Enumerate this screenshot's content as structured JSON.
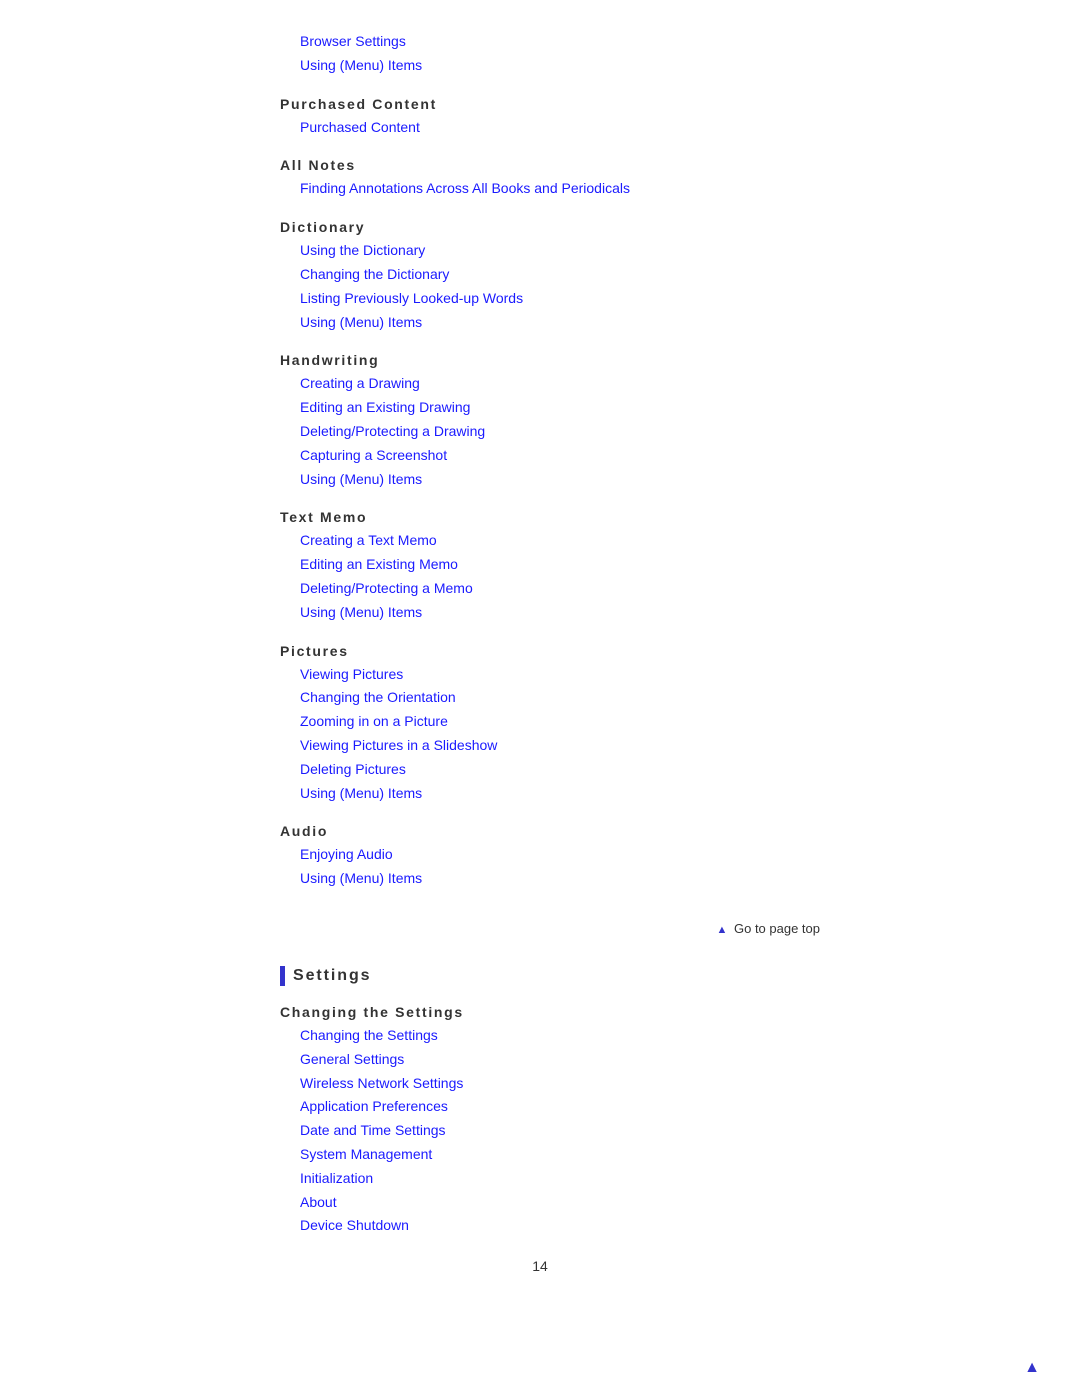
{
  "toc": {
    "sections": [
      {
        "id": "purchased-content-section",
        "header": "Purchased Content",
        "header_style": "spaced",
        "items": [
          {
            "id": "purchased-content-link",
            "label": "Purchased Content"
          }
        ]
      },
      {
        "id": "all-notes-section",
        "header": "All Notes",
        "header_style": "spaced",
        "items": [
          {
            "id": "finding-annotations-link",
            "label": "Finding Annotations Across All Books and Periodicals"
          }
        ]
      },
      {
        "id": "dictionary-section",
        "header": "Dictionary",
        "header_style": "spaced",
        "items": [
          {
            "id": "using-dictionary-link",
            "label": "Using the Dictionary"
          },
          {
            "id": "changing-dictionary-link",
            "label": "Changing the Dictionary"
          },
          {
            "id": "listing-words-link",
            "label": "Listing Previously Looked-up Words"
          },
          {
            "id": "dictionary-menu-link",
            "label": "Using (Menu) Items"
          }
        ]
      },
      {
        "id": "handwriting-section",
        "header": "Handwriting",
        "header_style": "spaced",
        "items": [
          {
            "id": "creating-drawing-link",
            "label": "Creating a Drawing"
          },
          {
            "id": "editing-drawing-link",
            "label": "Editing an Existing Drawing"
          },
          {
            "id": "deleting-drawing-link",
            "label": "Deleting/Protecting a Drawing"
          },
          {
            "id": "capturing-screenshot-link",
            "label": "Capturing a Screenshot"
          },
          {
            "id": "handwriting-menu-link",
            "label": "Using (Menu) Items"
          }
        ]
      },
      {
        "id": "text-memo-section",
        "header": "Text Memo",
        "header_style": "spaced",
        "items": [
          {
            "id": "creating-text-memo-link",
            "label": "Creating a Text Memo"
          },
          {
            "id": "editing-memo-link",
            "label": "Editing an Existing Memo"
          },
          {
            "id": "deleting-memo-link",
            "label": "Deleting/Protecting a Memo"
          },
          {
            "id": "text-memo-menu-link",
            "label": "Using (Menu) Items"
          }
        ]
      },
      {
        "id": "pictures-section",
        "header": "Pictures",
        "header_style": "spaced",
        "items": [
          {
            "id": "viewing-pictures-link",
            "label": "Viewing Pictures"
          },
          {
            "id": "changing-orientation-link",
            "label": "Changing the Orientation"
          },
          {
            "id": "zooming-picture-link",
            "label": "Zooming in on a Picture"
          },
          {
            "id": "viewing-slideshow-link",
            "label": "Viewing Pictures in a Slideshow"
          },
          {
            "id": "deleting-pictures-link",
            "label": "Deleting Pictures"
          },
          {
            "id": "pictures-menu-link",
            "label": "Using (Menu) Items"
          }
        ]
      },
      {
        "id": "audio-section",
        "header": "Audio",
        "header_style": "spaced",
        "items": [
          {
            "id": "enjoying-audio-link",
            "label": "Enjoying Audio"
          },
          {
            "id": "audio-menu-link",
            "label": "Using (Menu) Items"
          }
        ]
      }
    ],
    "settings_section": {
      "id": "settings-section",
      "header": "Settings",
      "subsections": [
        {
          "id": "changing-settings-subsection",
          "header": "Changing the Settings",
          "header_style": "spaced",
          "items": [
            {
              "id": "changing-settings-link",
              "label": "Changing the Settings"
            },
            {
              "id": "general-settings-link",
              "label": "General Settings"
            },
            {
              "id": "wireless-network-link",
              "label": "Wireless Network Settings"
            },
            {
              "id": "app-preferences-link",
              "label": "Application Preferences"
            },
            {
              "id": "date-time-link",
              "label": "Date and Time Settings"
            },
            {
              "id": "system-management-link",
              "label": "System Management"
            },
            {
              "id": "initialization-link",
              "label": "Initialization"
            },
            {
              "id": "about-link",
              "label": "About"
            },
            {
              "id": "device-shutdown-link",
              "label": "Device Shutdown"
            }
          ]
        }
      ]
    },
    "go_to_top": "▲ Go to page top",
    "page_number": "14",
    "top_links": [
      {
        "id": "browser-settings-link",
        "label": "Browser Settings"
      },
      {
        "id": "using-menu-items-top-link",
        "label": "Using (Menu) Items"
      }
    ]
  }
}
